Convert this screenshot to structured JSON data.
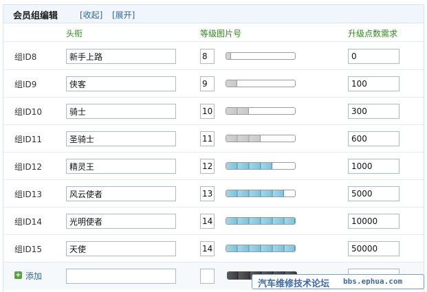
{
  "title": {
    "text": "会员组编辑",
    "collapse_link": "[收起]",
    "expand_link": "[展开]"
  },
  "columns": {
    "title": "头衔",
    "level_image": "等级图片号",
    "points": "升级点数需求"
  },
  "rows": [
    {
      "id_label": "组ID8",
      "name": "新手上路",
      "level": "8",
      "points": "0",
      "level_fill": 0.07,
      "fill_style": "gray"
    },
    {
      "id_label": "组ID9",
      "name": "侠客",
      "level": "9",
      "points": "100",
      "level_fill": 0.16,
      "fill_style": "gray"
    },
    {
      "id_label": "组ID10",
      "name": "骑士",
      "level": "10",
      "points": "300",
      "level_fill": 0.33,
      "fill_style": "gray"
    },
    {
      "id_label": "组ID11",
      "name": "圣骑士",
      "level": "11",
      "points": "600",
      "level_fill": 0.5,
      "fill_style": "gray"
    },
    {
      "id_label": "组ID12",
      "name": "精灵王",
      "level": "12",
      "points": "1000",
      "level_fill": 0.67,
      "fill_style": "blue"
    },
    {
      "id_label": "组ID13",
      "name": "风云使者",
      "level": "13",
      "points": "5000",
      "level_fill": 0.84,
      "fill_style": "blue"
    },
    {
      "id_label": "组ID14",
      "name": "光明使者",
      "level": "14",
      "points": "10000",
      "level_fill": 1.0,
      "fill_style": "blue"
    },
    {
      "id_label": "组ID15",
      "name": "天使",
      "level": "14",
      "points": "50000",
      "level_fill": 1.0,
      "fill_style": "blue"
    }
  ],
  "add_row": {
    "label": "添加",
    "name": "",
    "level": "",
    "points": ""
  },
  "watermark": {
    "text_cn": "汽车维修技术论坛",
    "text_url": "bbs.ephua.com"
  }
}
